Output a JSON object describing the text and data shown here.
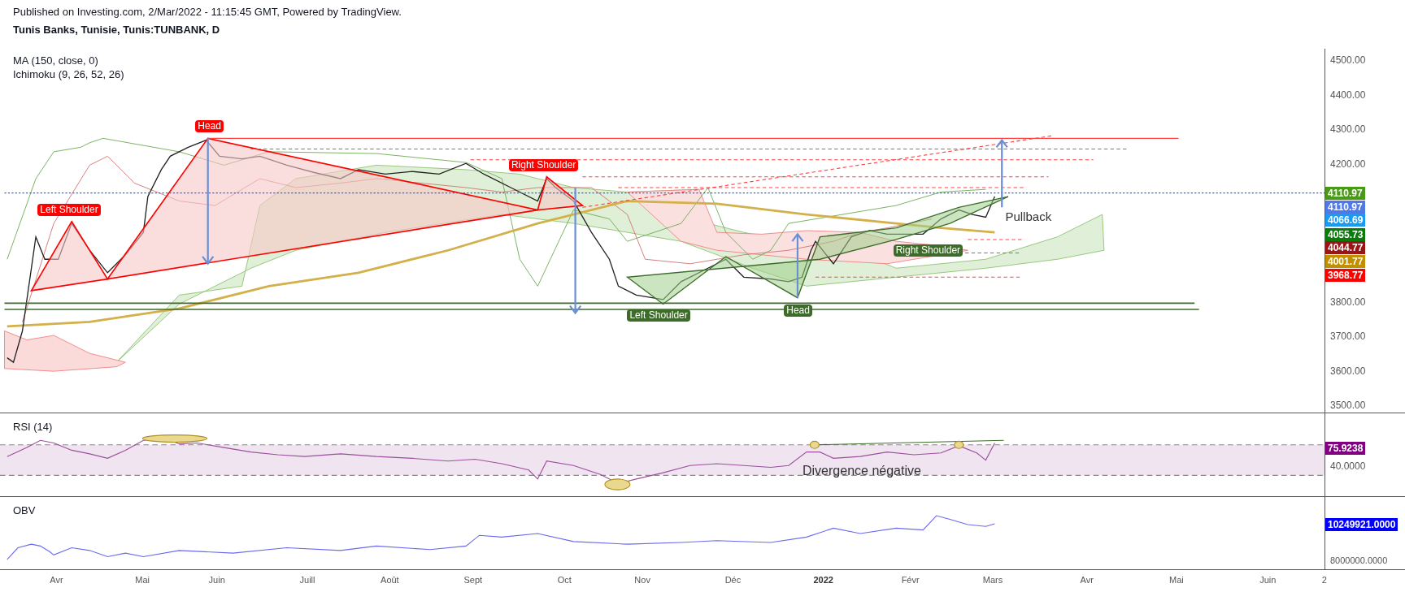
{
  "header": {
    "published": "Published on Investing.com, 2/Mar/2022 - 11:15:45 GMT, Powered by TradingView.",
    "symbol": "Tunis Banks, Tunisie, Tunis:TUNBANK, D"
  },
  "price_pane": {
    "indicators": [
      "MA (150, close, 0)",
      "Ichimoku (9, 26, 52, 26)"
    ],
    "annotations": [
      {
        "text": "Left Shoulder",
        "kind": "tag",
        "color": "#ff0000"
      },
      {
        "text": "Head",
        "kind": "tag",
        "color": "#ff0000"
      },
      {
        "text": "Right Shoulder",
        "kind": "tag",
        "color": "#ff0000"
      },
      {
        "text": "Left Shoulder",
        "kind": "tag",
        "color": "#3d6b2a"
      },
      {
        "text": "Head",
        "kind": "tag",
        "color": "#3d6b2a"
      },
      {
        "text": "Right Shoulder",
        "kind": "tag",
        "color": "#3d6b2a"
      },
      {
        "text": "Pullback",
        "kind": "note"
      }
    ],
    "axis_labels": [
      "4500.00",
      "4400.00",
      "4300.00",
      "4200.00",
      "3800.00",
      "3700.00",
      "3600.00",
      "3500.00"
    ],
    "price_tags": [
      {
        "value": "4110.97",
        "color": "#4a9a1a"
      },
      {
        "value": "4110.97",
        "color": "#4f79e6"
      },
      {
        "value": "4066.69",
        "color": "#1a9af0"
      },
      {
        "value": "4055.73",
        "color": "#0a7a0a"
      },
      {
        "value": "4044.77",
        "color": "#9a1515"
      },
      {
        "value": "4001.77",
        "color": "#c09000"
      },
      {
        "value": "3968.77",
        "color": "#ff0000"
      }
    ]
  },
  "rsi_pane": {
    "title": "RSI (14)",
    "annotation": "Divergence négative",
    "axis_label": "40.0000",
    "tag": {
      "value": "75.9238",
      "color": "#800080"
    }
  },
  "obv_pane": {
    "title": "OBV",
    "axis_label": "8000000.0000",
    "tag": {
      "value": "10249921.0000",
      "color": "#0000ff"
    }
  },
  "time_axis": [
    {
      "label": "Avr",
      "kind": "month"
    },
    {
      "label": "Mai",
      "kind": "month"
    },
    {
      "label": "Juin",
      "kind": "month"
    },
    {
      "label": "Juill",
      "kind": "month"
    },
    {
      "label": "Août",
      "kind": "month"
    },
    {
      "label": "Sept",
      "kind": "month"
    },
    {
      "label": "Oct",
      "kind": "month"
    },
    {
      "label": "Nov",
      "kind": "month"
    },
    {
      "label": "Déc",
      "kind": "month"
    },
    {
      "label": "2022",
      "kind": "year"
    },
    {
      "label": "Févr",
      "kind": "month"
    },
    {
      "label": "Mars",
      "kind": "month"
    },
    {
      "label": "Avr",
      "kind": "month"
    },
    {
      "label": "Mai",
      "kind": "month"
    },
    {
      "label": "Juin",
      "kind": "month"
    },
    {
      "label": "2",
      "kind": "month"
    }
  ]
}
